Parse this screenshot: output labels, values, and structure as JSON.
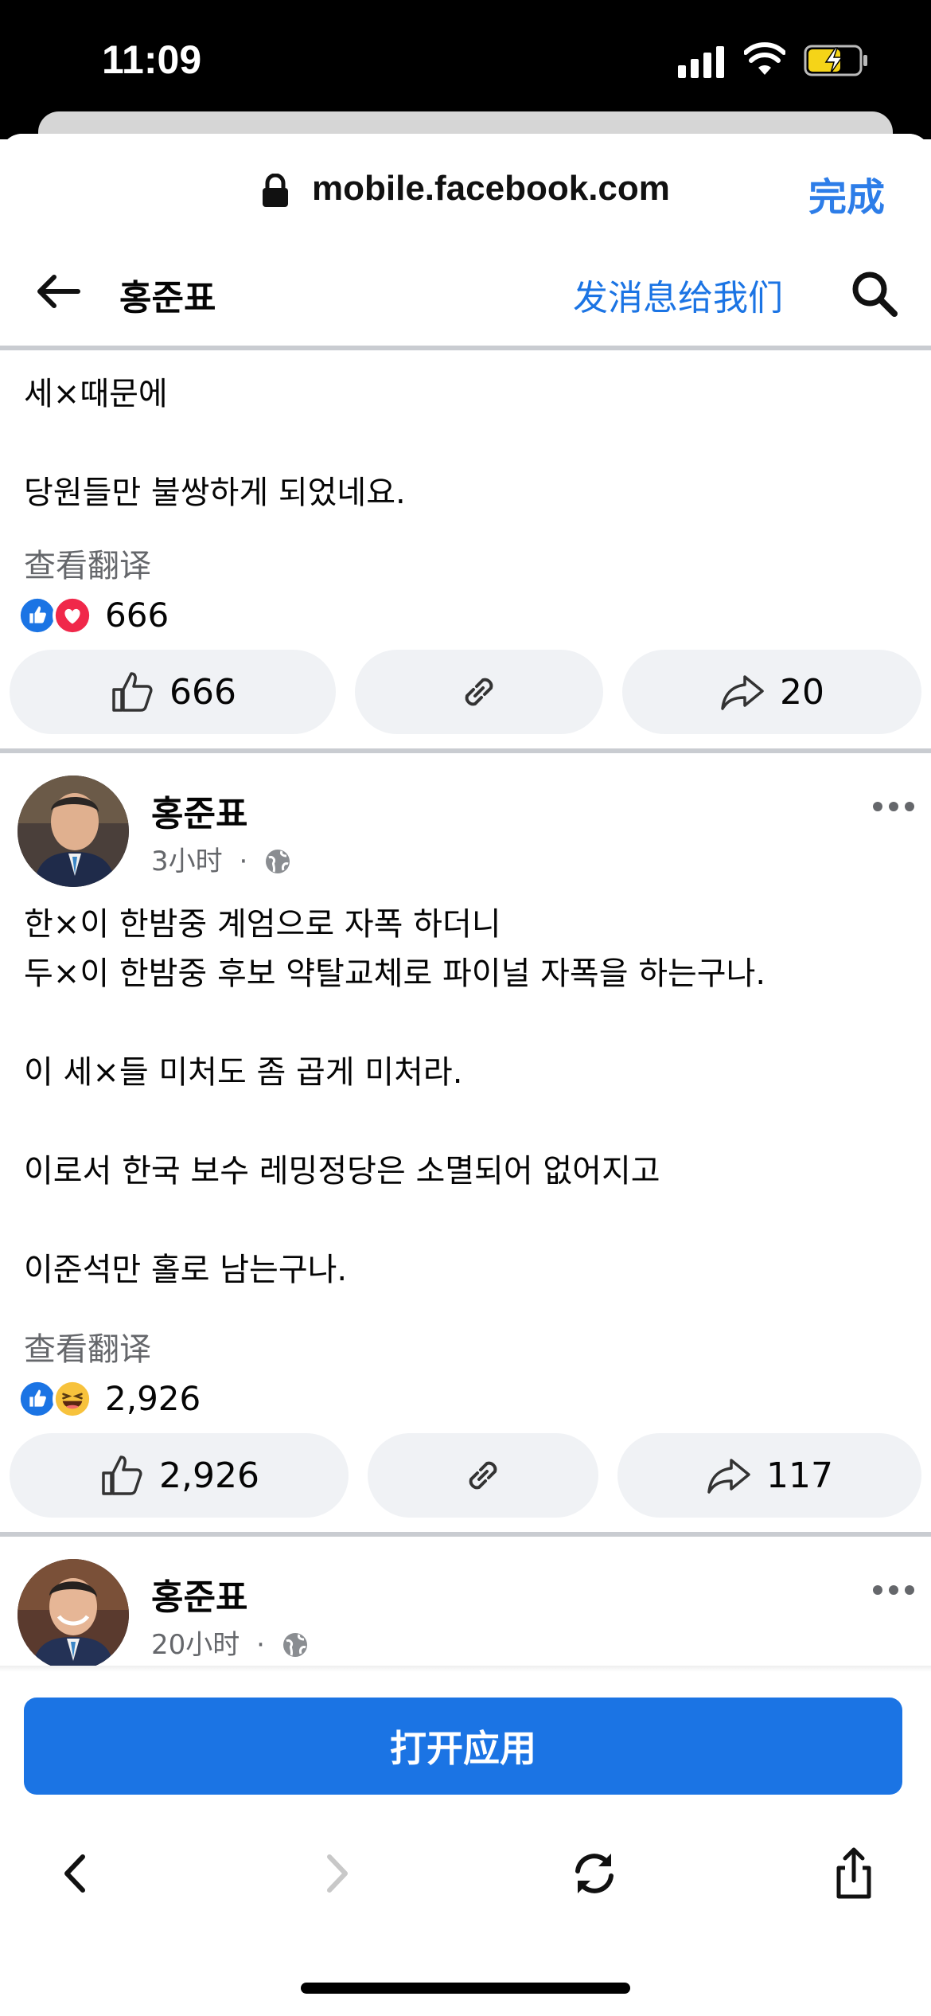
{
  "status": {
    "time": "11:09"
  },
  "browser": {
    "url": "mobile.facebook.com",
    "done_label": "完成"
  },
  "header": {
    "page_name": "홍준표",
    "message_label": "发消息给我们"
  },
  "posts": [
    {
      "text_lines": [
        "세×때문에",
        "",
        "당원들만 불쌍하게 되었네요."
      ],
      "translate_label": "查看翻译",
      "reaction_count": "666",
      "like_count": "666",
      "share_count": "20",
      "reactions": [
        "like",
        "love"
      ]
    },
    {
      "author": "홍준표",
      "time": "3小时",
      "dot": "·",
      "text_lines": [
        "한×이 한밤중 계엄으로 자폭 하더니",
        "두×이 한밤중 후보 약탈교체로 파이널 자폭을 하는구나.",
        "",
        "이 세×들 미처도 좀 곱게 미처라.",
        "",
        "이로서 한국 보수 레밍정당은 소멸되어 없어지고",
        "",
        "이준석만 홀로 남는구나."
      ],
      "translate_label": "查看翻译",
      "reaction_count": "2,926",
      "like_count": "2,926",
      "share_count": "117",
      "reactions": [
        "like",
        "haha"
      ]
    },
    {
      "author": "홍준표",
      "time": "20小时",
      "dot": "·"
    }
  ],
  "open_app_label": "打开应用",
  "colors": {
    "fb_blue": "#1b74e4",
    "ios_blue": "#2d7de8",
    "pill_bg": "#f0f2f5",
    "muted": "#65676b"
  },
  "icons": [
    "lock-icon",
    "back-arrow-icon",
    "search-icon",
    "like-icon",
    "link-icon",
    "share-icon",
    "globe-icon",
    "more-icon",
    "safari-back-icon",
    "safari-forward-icon",
    "reload-icon",
    "share-sheet-icon"
  ]
}
